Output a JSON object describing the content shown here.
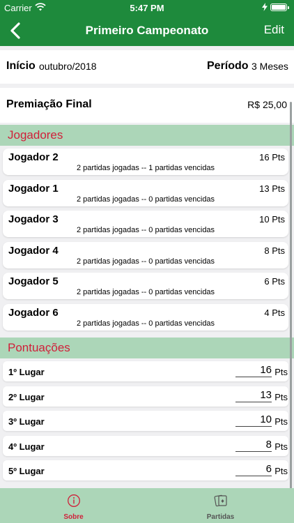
{
  "status_bar": {
    "carrier": "Carrier",
    "time": "5:47 PM"
  },
  "nav": {
    "title": "Primeiro Campeonato",
    "edit_label": "Edit",
    "back_icon": "chevron-left-icon"
  },
  "info": {
    "start_label": "Início",
    "start_value": "outubro/2018",
    "period_label": "Período",
    "period_value": "3 Meses"
  },
  "prize": {
    "label": "Premiação Final",
    "value": "R$ 25,00"
  },
  "players_section": {
    "title": "Jogadores"
  },
  "players": [
    {
      "name": "Jogador 2",
      "points": "16 Pts",
      "detail": "2 partidas jogadas -- 1 partidas vencidas"
    },
    {
      "name": "Jogador 1",
      "points": "13 Pts",
      "detail": "2 partidas jogadas -- 0 partidas vencidas"
    },
    {
      "name": "Jogador 3",
      "points": "10 Pts",
      "detail": "2 partidas jogadas -- 0 partidas vencidas"
    },
    {
      "name": "Jogador 4",
      "points": "8 Pts",
      "detail": "2 partidas jogadas -- 0 partidas vencidas"
    },
    {
      "name": "Jogador 5",
      "points": "6 Pts",
      "detail": "2 partidas jogadas -- 0 partidas vencidas"
    },
    {
      "name": "Jogador 6",
      "points": "4 Pts",
      "detail": "2 partidas jogadas -- 0 partidas vencidas"
    }
  ],
  "scores_section": {
    "title": "Pontuações"
  },
  "scores": [
    {
      "label": "1º Lugar",
      "value": "16",
      "unit": "Pts"
    },
    {
      "label": "2º Lugar",
      "value": "13",
      "unit": "Pts"
    },
    {
      "label": "3º Lugar",
      "value": "10",
      "unit": "Pts"
    },
    {
      "label": "4º Lugar",
      "value": "8",
      "unit": "Pts"
    },
    {
      "label": "5º Lugar",
      "value": "6",
      "unit": "Pts"
    }
  ],
  "tabs": [
    {
      "label": "Sobre",
      "icon": "info-icon",
      "selected": true
    },
    {
      "label": "Partidas",
      "icon": "cards-icon",
      "selected": false
    }
  ],
  "colors": {
    "nav": "#1e8a3c",
    "section": "#acd6b8",
    "accent": "#d0203a",
    "tab_inactive": "#555555"
  }
}
